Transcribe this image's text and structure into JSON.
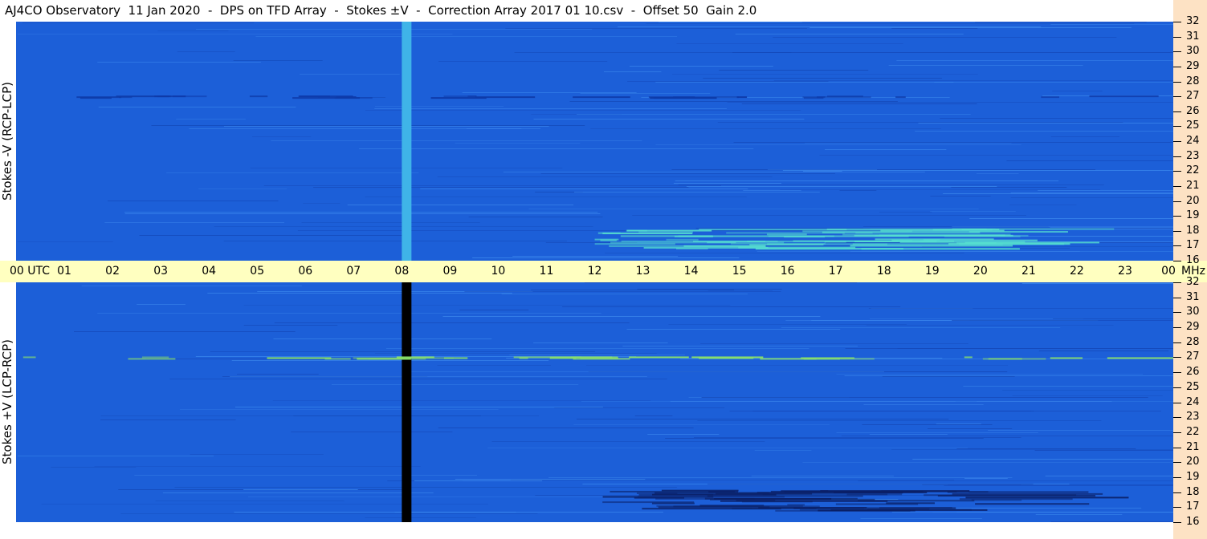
{
  "title": "AJ4CO Observatory  11 Jan 2020  -  DPS on TFD Array  -  Stokes ±V  -  Correction Array 2017 01 10.csv  -  Offset 50  Gain 2.0",
  "chart_data": [
    {
      "type": "heatmap",
      "panel": "top",
      "ylabel": "Stokes -V (RCP-LCP)",
      "y_ticks": [
        "16",
        "17",
        "18",
        "19",
        "20",
        "21",
        "22",
        "23",
        "24",
        "25",
        "26",
        "27",
        "28",
        "29",
        "30",
        "31",
        "32"
      ],
      "ylim": [
        16,
        32
      ],
      "y_unit": "MHz",
      "x_ticks": [
        "00  UTC",
        "01",
        "02",
        "03",
        "04",
        "05",
        "06",
        "07",
        "08",
        "09",
        "10",
        "11",
        "12",
        "13",
        "14",
        "15",
        "16",
        "17",
        "18",
        "19",
        "20",
        "21",
        "22",
        "23",
        "00"
      ],
      "xlim": [
        0,
        24
      ],
      "background_color": "#1c5fd8",
      "features": [
        {
          "kind": "vertical-band",
          "x_hours": [
            8.0,
            8.2
          ],
          "color": "#3fb4e8"
        },
        {
          "kind": "horizontal-line",
          "freq_mhz": 27.0,
          "x_hours": [
            0,
            24
          ],
          "color": "#0e3aa8"
        },
        {
          "kind": "emission",
          "freq_mhz": [
            16.8,
            18.2
          ],
          "x_hours": [
            12.0,
            22.0
          ],
          "color": "#56e0d0"
        }
      ]
    },
    {
      "type": "heatmap",
      "panel": "bottom",
      "ylabel": "Stokes +V (LCP-RCP)",
      "y_ticks": [
        "16",
        "17",
        "18",
        "19",
        "20",
        "21",
        "22",
        "23",
        "24",
        "25",
        "26",
        "27",
        "28",
        "29",
        "30",
        "31",
        "32"
      ],
      "ylim": [
        16,
        32
      ],
      "y_unit": "MHz",
      "x_ticks": [
        "00  UTC",
        "01",
        "02",
        "03",
        "04",
        "05",
        "06",
        "07",
        "08",
        "09",
        "10",
        "11",
        "12",
        "13",
        "14",
        "15",
        "16",
        "17",
        "18",
        "19",
        "20",
        "21",
        "22",
        "23",
        "00"
      ],
      "xlim": [
        0,
        24
      ],
      "background_color": "#1c5fd8",
      "features": [
        {
          "kind": "vertical-band",
          "x_hours": [
            8.0,
            8.2
          ],
          "color": "#000000"
        },
        {
          "kind": "horizontal-line",
          "freq_mhz": 27.0,
          "x_hours": [
            0,
            24
          ],
          "color": "#8ae06a"
        },
        {
          "kind": "emission",
          "freq_mhz": [
            16.8,
            18.2
          ],
          "x_hours": [
            12.0,
            22.0
          ],
          "color": "#0a1f66"
        }
      ]
    }
  ],
  "x_unit": "MHz",
  "colors": {
    "time_axis_bg": "#ffffc0",
    "freq_axis_bg": "#fde2c4"
  }
}
